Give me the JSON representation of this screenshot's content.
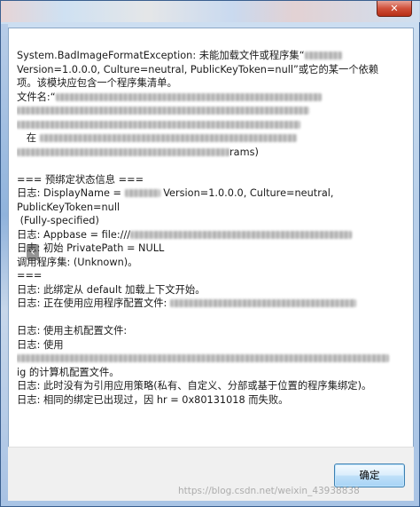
{
  "window": {
    "close_label": "✕"
  },
  "message": {
    "lines": [
      {
        "text": "System.BadImageFormatException: 未能加载文件或程序集“",
        "redact": 42,
        "tail": ""
      },
      {
        "text": "Version=1.0.0.0, Culture=neutral, PublicKeyToken=null”或它的某一个依赖",
        "redact": 0,
        "tail": ""
      },
      {
        "text": "项。该模块应包含一个程序集清单。",
        "redact": 0,
        "tail": ""
      },
      {
        "text": "文件名:“",
        "redact": 300,
        "tail": ""
      },
      {
        "text": "",
        "redact": 330,
        "tail": ""
      },
      {
        "text": "",
        "redact": 320,
        "tail": ""
      },
      {
        "text": "   在 ",
        "redact": 290,
        "tail": ""
      },
      {
        "text": "",
        "redact": 240,
        "tail": "rams)"
      },
      {
        "text": "",
        "redact": 0,
        "tail": ""
      },
      {
        "text": "=== 预绑定状态信息 ===",
        "redact": 0,
        "tail": ""
      },
      {
        "text": "日志: DisplayName = ",
        "redact": 40,
        "tail": " Version=1.0.0.0, Culture=neutral,"
      },
      {
        "text": "PublicKeyToken=null",
        "redact": 0,
        "tail": ""
      },
      {
        "text": " (Fully-specified)",
        "redact": 0,
        "tail": ""
      },
      {
        "text": "日志: Appbase = file:///",
        "redact": 250,
        "tail": ""
      },
      {
        "text": "日志: 初始 PrivatePath = NULL",
        "redact": 0,
        "tail": ""
      },
      {
        "text": "调用程序集: (Unknown)。",
        "redact": 0,
        "tail": ""
      },
      {
        "text": "===",
        "redact": 0,
        "tail": ""
      },
      {
        "text": "日志: 此绑定从 default 加载上下文开始。",
        "redact": 0,
        "tail": ""
      },
      {
        "text": "日志: 正在使用应用程序配置文件: ",
        "redact": 210,
        "tail": ""
      },
      {
        "text": "",
        "redact": 0,
        "tail": ""
      },
      {
        "text": "日志: 使用主机配置文件:",
        "redact": 0,
        "tail": ""
      },
      {
        "text": "日志: 使用",
        "redact": 0,
        "tail": ""
      },
      {
        "text": "",
        "redact": 420,
        "tail": ""
      },
      {
        "text": "ig 的计算机配置文件。",
        "redact": 0,
        "tail": ""
      },
      {
        "text": "日志: 此时没有为引用应用策略(私有、自定义、分部或基于位置的程序集绑定)。",
        "redact": 0,
        "tail": ""
      },
      {
        "text": "日志: 相同的绑定已出现过，因 hr = 0x80131018 而失败。",
        "redact": 0,
        "tail": ""
      }
    ]
  },
  "buttons": {
    "ok_label": "确定"
  },
  "watermark": {
    "text": "https://blog.csdn.net/weixin_43938838"
  }
}
